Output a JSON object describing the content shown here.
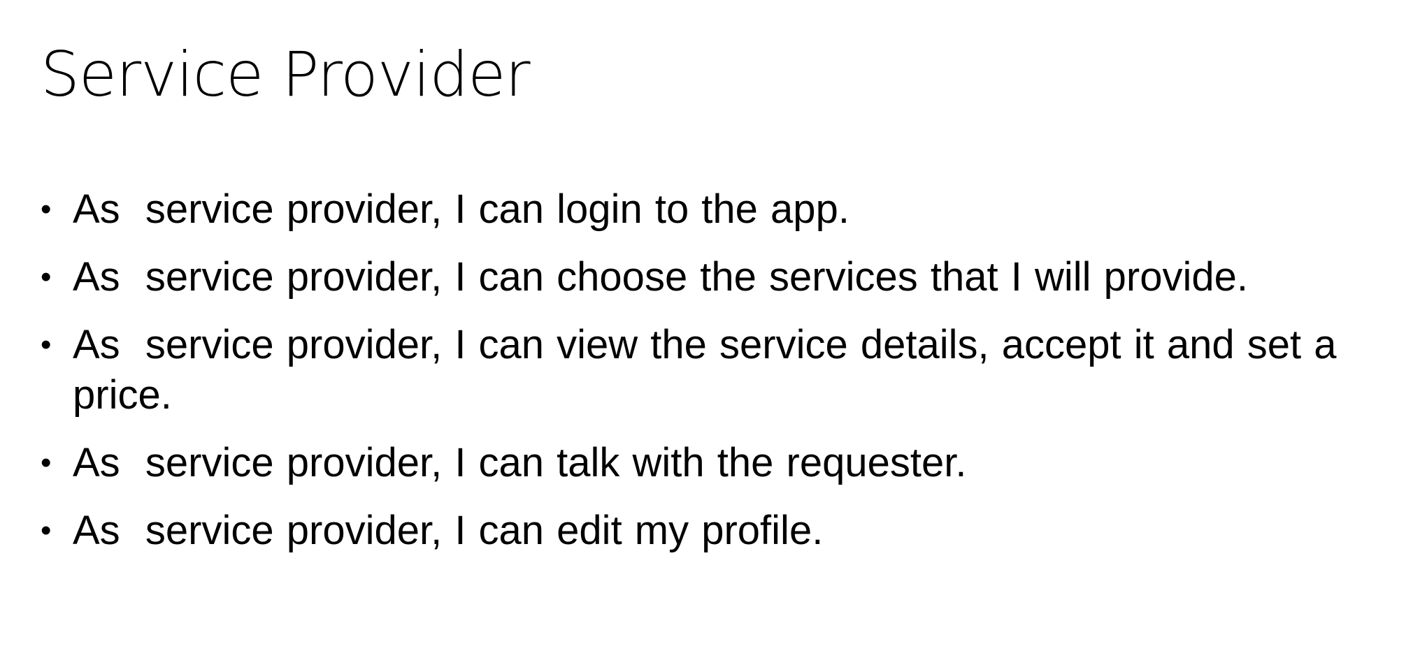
{
  "slide": {
    "title": "Service Provider",
    "bullet_symbol": "•",
    "bullets": [
      "As  service provider, I can login to the app.",
      "As  service provider, I can choose the services that I will provide.",
      "As  service provider, I can view the service details, accept it and set a price.",
      "As  service provider, I can talk with the requester.",
      "As  service provider, I can edit my profile."
    ]
  }
}
